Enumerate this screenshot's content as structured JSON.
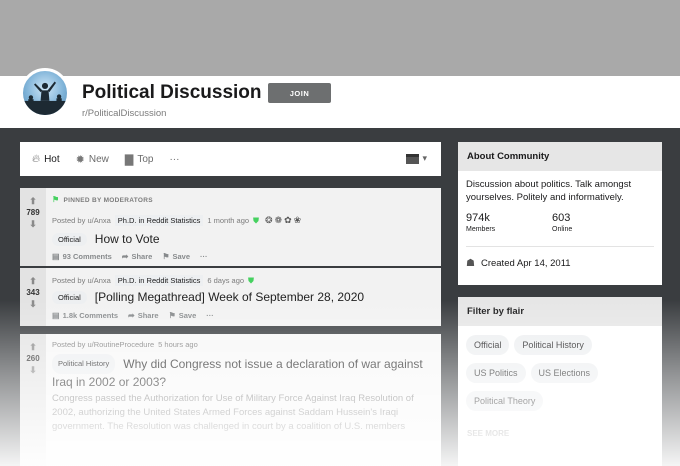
{
  "subreddit": {
    "title": "Political Discussion",
    "name": "r/PoliticalDiscussion",
    "join_label": "JOIN"
  },
  "sort": {
    "options": [
      "Hot",
      "New",
      "Top"
    ],
    "more_label": "···"
  },
  "posts": [
    {
      "pinned_label": "PINNED BY MODERATORS",
      "votes": "789",
      "posted_by": "Posted by u/Anxa",
      "user_flair": "Ph.D. in Reddit Statistics",
      "time": "1 month ago",
      "flair": "Official",
      "title": "How to Vote",
      "comments": "93 Comments",
      "share": "Share",
      "save": "Save",
      "more": "···"
    },
    {
      "votes": "343",
      "posted_by": "Posted by u/Anxa",
      "user_flair": "Ph.D. in Reddit Statistics",
      "time": "6 days ago",
      "flair": "Official",
      "title": "[Polling Megathread] Week of September 28, 2020",
      "comments": "1.8k Comments",
      "share": "Share",
      "save": "Save",
      "more": "···"
    },
    {
      "votes": "260",
      "posted_by": "Posted by u/RoutineProcedure",
      "time": "5 hours ago",
      "flair": "Political History",
      "title": "Why did Congress not issue a declaration of war against Iraq in 2002 or 2003?",
      "body": "Congress passed the Authorization for Use of Military Force Against Iraq Resolution of 2002, authorizing the United States Armed Forces against Saddam Hussein's Iraqi government. The Resolution was challenged in court by a coalition of U.S. members"
    }
  ],
  "about": {
    "heading": "About Community",
    "description": "Discussion about politics. Talk amongst yourselves. Politely and informatively.",
    "members_value": "974k",
    "members_label": "Members",
    "online_value": "603",
    "online_label": "Online",
    "created": "Created Apr 14, 2011"
  },
  "flair_filter": {
    "heading": "Filter by flair",
    "flairs": [
      "Official",
      "Political History",
      "US Politics",
      "US Elections",
      "Political Theory"
    ],
    "see_more": "SEE MORE"
  },
  "colors": {
    "banner": "#a9a9a9",
    "background": "#3a3d40",
    "join_button": "#6d6f70",
    "mod_green": "#46d160"
  }
}
